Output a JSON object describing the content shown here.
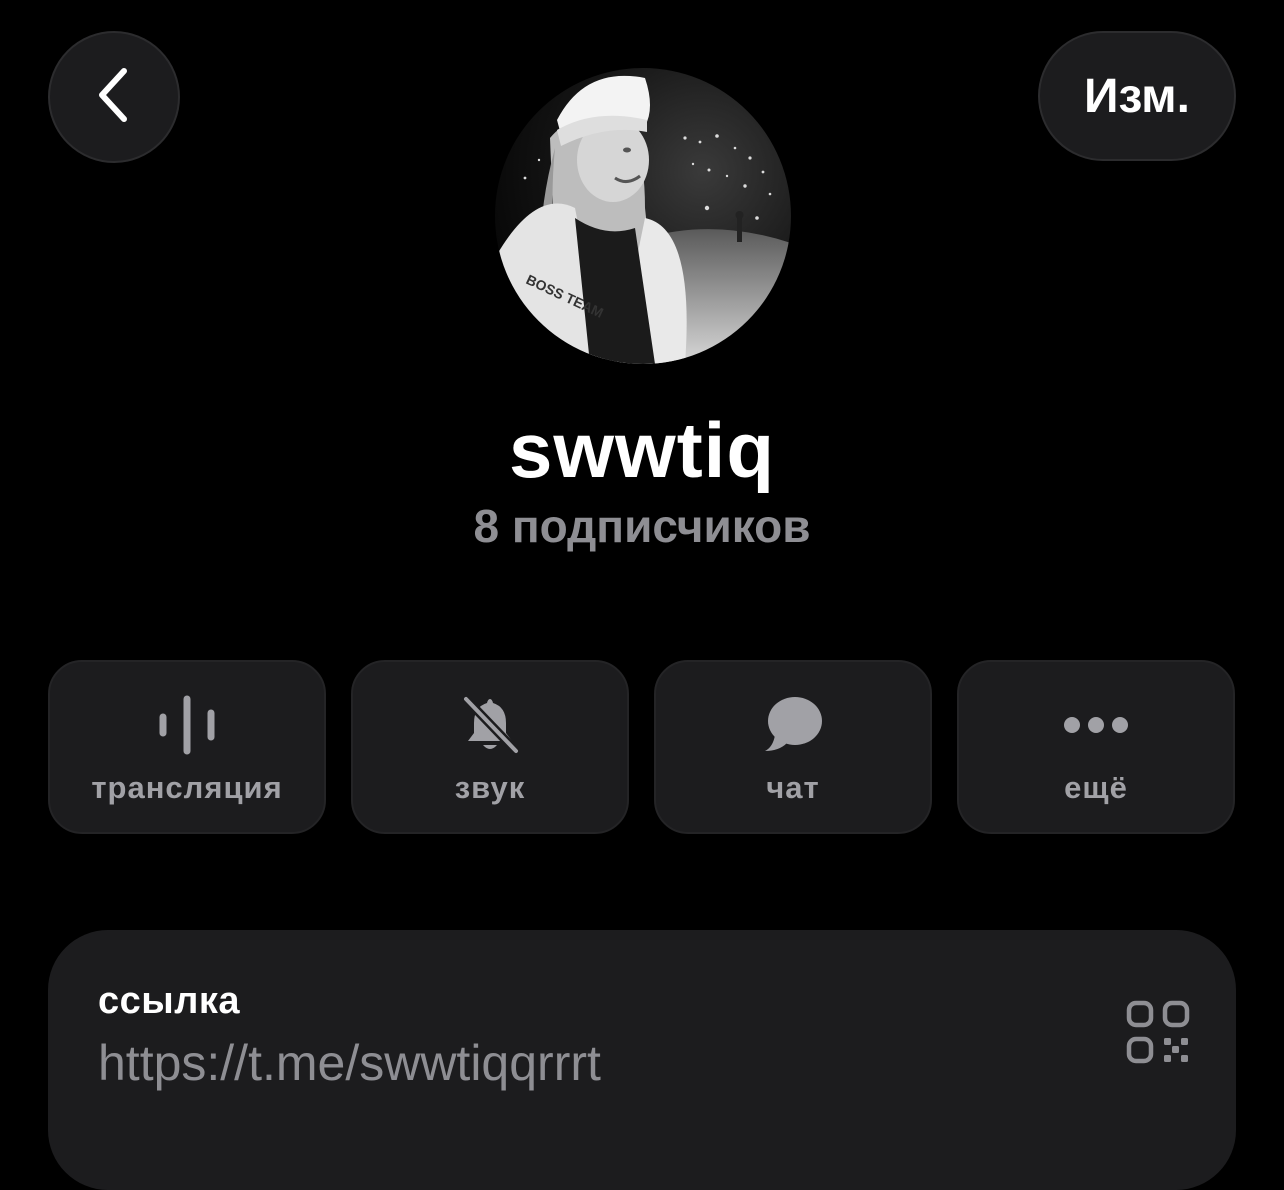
{
  "header": {
    "back_icon": "chevron-left-icon",
    "edit_label": "Изм."
  },
  "profile": {
    "name": "swwtiq",
    "subscribers": "8 подписчиков",
    "avatar": "avatar-photo"
  },
  "actions": [
    {
      "icon": "broadcast-wave-icon",
      "label": "трансляция"
    },
    {
      "icon": "bell-slash-icon",
      "label": "звук"
    },
    {
      "icon": "chat-bubble-icon",
      "label": "чат"
    },
    {
      "icon": "more-dots-icon",
      "label": "ещё"
    }
  ],
  "info": {
    "link_label": "ссылка",
    "link_value": "https://t.me/swwtiqqrrrt",
    "qr_icon": "qr-code-icon"
  },
  "colors": {
    "background": "#000000",
    "surface": "#1c1c1e",
    "secondary_text": "#8e8e93",
    "icon_gray": "#a1a1a6"
  }
}
